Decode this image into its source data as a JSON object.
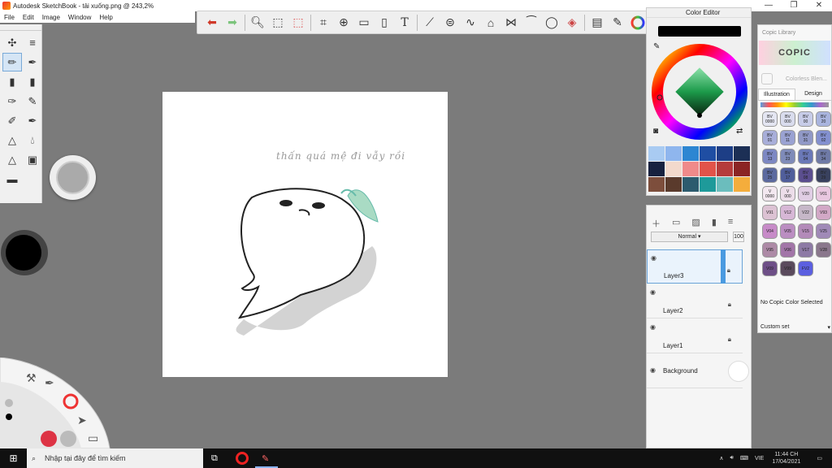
{
  "window": {
    "title": "Autodesk SketchBook - tải xuống.png @ 243,2%"
  },
  "menu": [
    "File",
    "Edit",
    "Image",
    "Window",
    "Help"
  ],
  "toolbar": {
    "tools": [
      "undo-icon",
      "redo-icon",
      "zoom-icon",
      "select-icon",
      "lasso-icon",
      "crop-icon",
      "transform-icon",
      "distort-icon",
      "fill-icon",
      "text-icon",
      "ruler-icon",
      "ellipse-guide-icon",
      "curve-icon",
      "perspective-icon",
      "symmetry-icon",
      "stroke-icon",
      "circle-icon",
      "eraser-icon",
      "layers-toggle-icon",
      "brush-palette-icon",
      "color-wheel-icon",
      "copic-icon"
    ]
  },
  "color_editor": {
    "title": "Color Editor",
    "swatches": [
      "#a9cbf2",
      "#8fb6ee",
      "#2d86d2",
      "#1f4ea3",
      "#1d3e86",
      "#1c2f55",
      "#17213f",
      "#f2d9cc",
      "#ef8a8a",
      "#e2534a",
      "#b53b3b",
      "#8b2424",
      "#7d4e3c",
      "#5a3a2c",
      "#2c5b6e",
      "#1e9a9a",
      "#6bbdbd",
      "#f4ad3c"
    ]
  },
  "layers": {
    "blend_mode": "Normal",
    "opacity": "100",
    "items": [
      {
        "name": "Layer3",
        "selected": true
      },
      {
        "name": "Layer2",
        "selected": false
      },
      {
        "name": "Layer1",
        "selected": false
      },
      {
        "name": "Background",
        "selected": false
      }
    ]
  },
  "copic": {
    "title": "Copic Library",
    "logo": "COPIC",
    "colorless": "Colorless Blen...",
    "tabs": [
      "Illustration",
      "Design"
    ],
    "colors": [
      {
        "code": "BV\n0000",
        "color": "#e4e6f2"
      },
      {
        "code": "BV\n000",
        "color": "#d9dced"
      },
      {
        "code": "BV\n00",
        "color": "#c7cce8"
      },
      {
        "code": "BV\n20",
        "color": "#a9b4de"
      },
      {
        "code": "BV\n01",
        "color": "#a8aed9"
      },
      {
        "code": "BV\n11",
        "color": "#9aa2d2"
      },
      {
        "code": "BV\n31",
        "color": "#9098c6"
      },
      {
        "code": "BV\n02",
        "color": "#8390cf"
      },
      {
        "code": "BV\n13",
        "color": "#7d88c3"
      },
      {
        "code": "BV\n23",
        "color": "#7f8bb9"
      },
      {
        "code": "BV\n04",
        "color": "#6a78b7"
      },
      {
        "code": "BV\n34",
        "color": "#6f7aa6"
      },
      {
        "code": "BV\n25",
        "color": "#5c6a9f"
      },
      {
        "code": "BV\n17",
        "color": "#505e9b"
      },
      {
        "code": "BV\n08",
        "color": "#5b4e8f"
      },
      {
        "code": "BV\n29",
        "color": "#39415e"
      },
      {
        "code": "V\n0000",
        "color": "#f3e8f0"
      },
      {
        "code": "V\n000",
        "color": "#ecdde9"
      },
      {
        "code": "V20",
        "color": "#e0cde4"
      },
      {
        "code": "V01",
        "color": "#e8c7df"
      },
      {
        "code": "V91",
        "color": "#dcc2d3"
      },
      {
        "code": "V12",
        "color": "#d7b7d6"
      },
      {
        "code": "V22",
        "color": "#c6b7c8"
      },
      {
        "code": "V93",
        "color": "#d2a8c6"
      },
      {
        "code": "V04",
        "color": "#c78bc8"
      },
      {
        "code": "V05",
        "color": "#bb8ec2"
      },
      {
        "code": "V15",
        "color": "#b38ab9"
      },
      {
        "code": "V25",
        "color": "#a08ab7"
      },
      {
        "code": "V95",
        "color": "#ad8aa6"
      },
      {
        "code": "V06",
        "color": "#a275a8"
      },
      {
        "code": "V17",
        "color": "#8d7aa5"
      },
      {
        "code": "V28",
        "color": "#8a778c"
      },
      {
        "code": "V09",
        "color": "#6e4f87"
      },
      {
        "code": "V99",
        "color": "#5a4a5c"
      },
      {
        "code": "FV2",
        "color": "#5b5fe0"
      }
    ],
    "no_color": "No Copic Color Selected",
    "custom_set": "Custom set"
  },
  "canvas": {
    "handwriting": "thấn quá mệ đi vẫy rồi"
  },
  "taskbar": {
    "search_placeholder": "Nhập tại đây để tìm kiếm",
    "lang": "VIE",
    "time": "11:44 CH",
    "date": "17/04/2021"
  }
}
